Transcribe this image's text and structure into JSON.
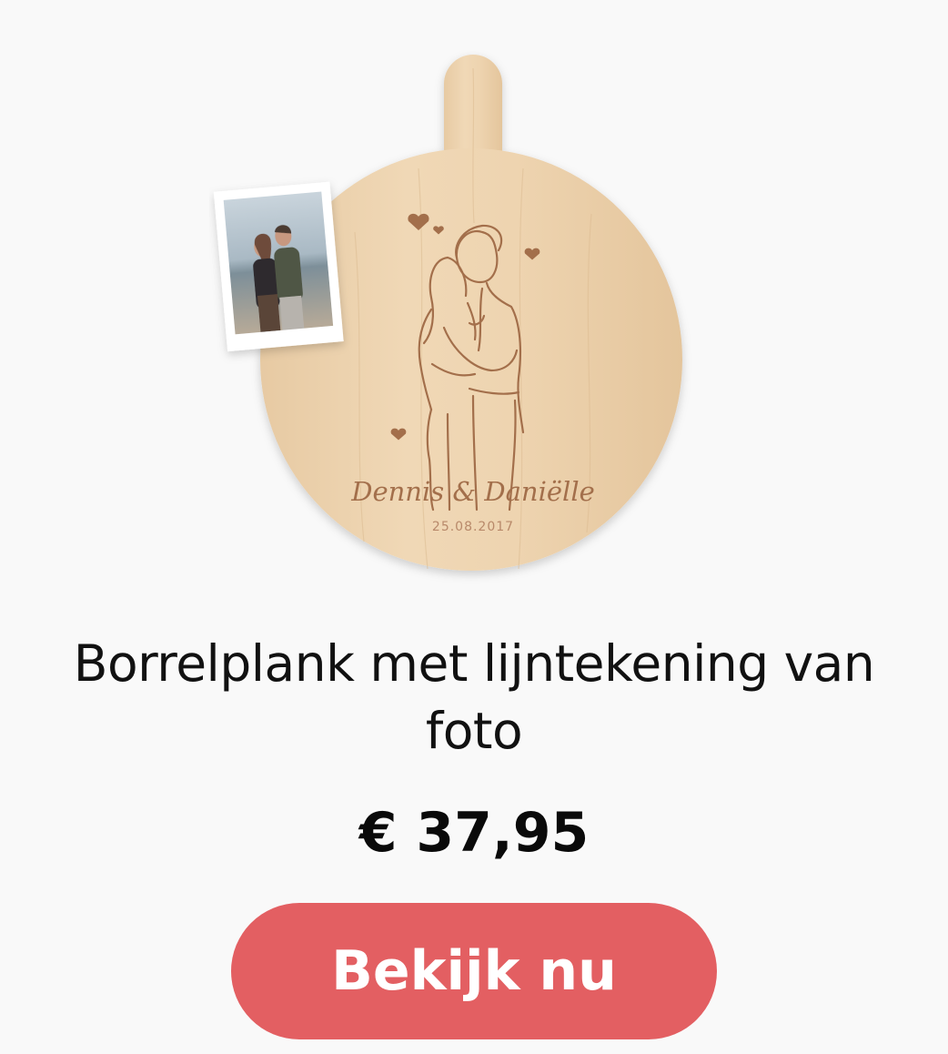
{
  "product": {
    "image": {
      "engraving_names": "Dennis & Daniëlle",
      "engraving_date": "25.08.2017",
      "photo_subject": "couple-photo"
    },
    "title": "Borrelplank met lijntekening van foto",
    "price": "€ 37,95",
    "cta_label": "Bekijk nu"
  },
  "colors": {
    "background": "#f9f9f9",
    "cta_background": "#e35f62",
    "cta_text": "#ffffff",
    "wood": "#ecd2ae",
    "engraving": "#a36f4b"
  }
}
